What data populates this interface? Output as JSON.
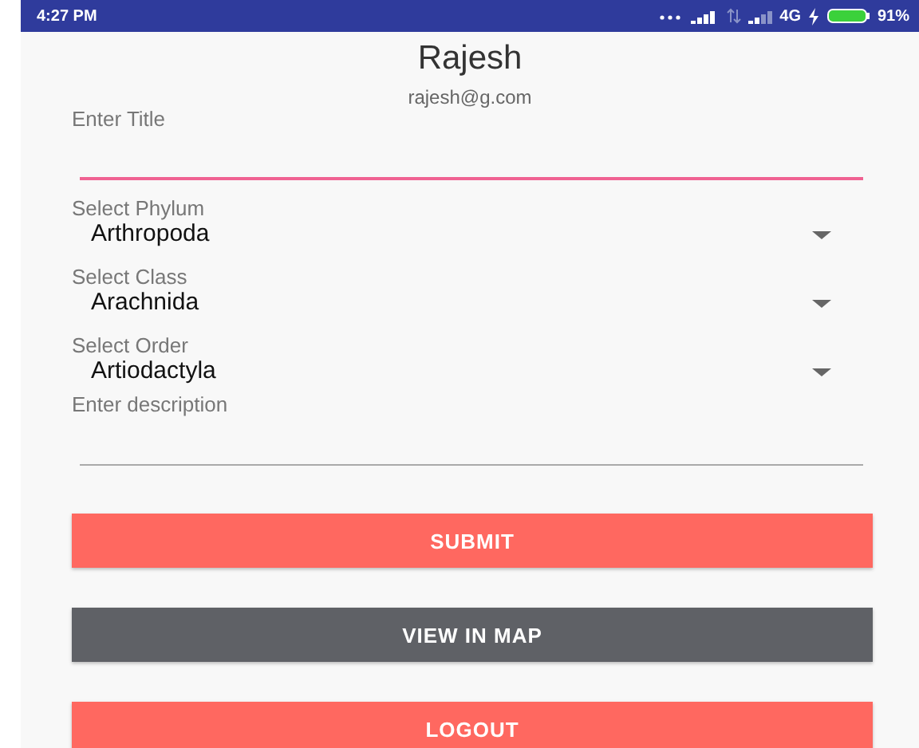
{
  "status_bar": {
    "time": "4:27 PM",
    "network": "4G",
    "battery": "91%"
  },
  "profile": {
    "name": "Rajesh",
    "email": "rajesh@g.com"
  },
  "form": [
    {
      "kind": "text",
      "label": "Enter Title",
      "focused": true
    },
    {
      "kind": "select",
      "label": "Select Phylum",
      "value": "Arthropoda"
    },
    {
      "kind": "select",
      "label": "Select Class",
      "value": "Arachnida"
    },
    {
      "kind": "select",
      "label": "Select Order",
      "value": "Artiodactyla"
    },
    {
      "kind": "text",
      "label": "Enter description",
      "focused": false
    }
  ],
  "buttons": [
    {
      "label": "SUBMIT",
      "kind": "accent"
    },
    {
      "label": "VIEW IN MAP",
      "kind": "dark"
    },
    {
      "label": "LOGOUT",
      "kind": "accent"
    }
  ]
}
